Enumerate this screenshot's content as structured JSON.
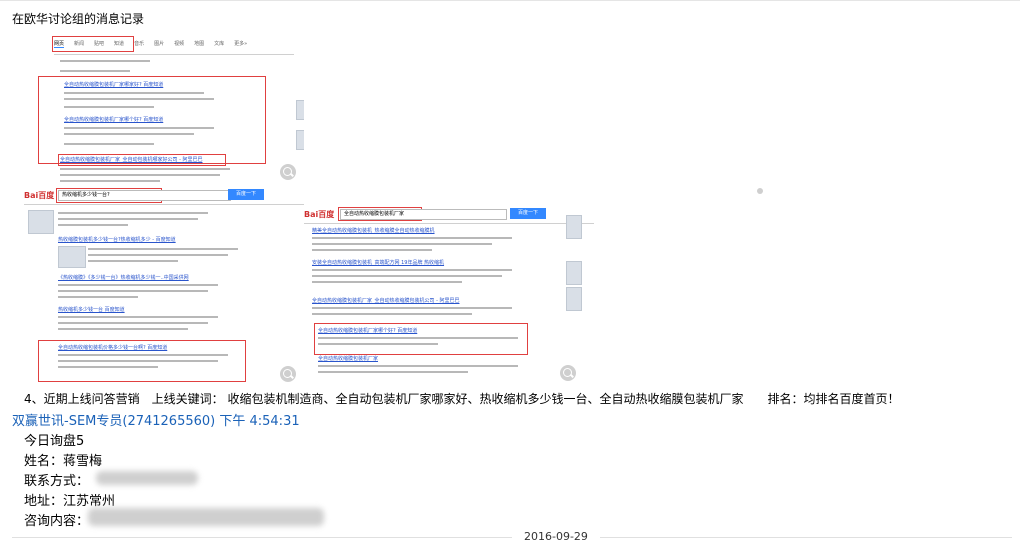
{
  "page": {
    "title": "在欧华讨论组的消息记录"
  },
  "shot_top": {
    "tabs": [
      "网页",
      "新闻",
      "贴吧",
      "知道",
      "音乐",
      "图片",
      "视频",
      "地图",
      "文库",
      "更多»"
    ],
    "results": [
      {
        "link": "全自动热收缩膜包装机厂家哪家好? 百度知道"
      },
      {
        "link": "全自动热收缩膜包装机厂家哪个好? 百度知道"
      },
      {
        "link": "全自动热收缩膜包装机厂家_全自动包装机哪家好公司 - 阿里巴巴"
      }
    ]
  },
  "shot_left": {
    "logo": "Bai百度",
    "query": "热收缩机多少钱一台?",
    "search_button": "百度一下",
    "results": [
      {
        "link": "热收缩膜包装机多少钱一台?热收缩机多少 - 百度知道"
      },
      {
        "link": "《热收缩膜》《多少钱一台》热收缩机多少钱一..中国采供网"
      },
      {
        "link": "热收缩机多少钱一台 百度知道"
      },
      {
        "link": "全自动热收缩包装机价格多少钱一台啊? 百度知道"
      }
    ]
  },
  "shot_right": {
    "logo": "Bai百度",
    "query": "全自动热收缩膜包装机厂家",
    "search_button": "百度一下",
    "results": [
      {
        "link": "精美全自动热收缩膜包装机_热收缩膜全自动热收缩膜机"
      },
      {
        "link": "安装全自动热收缩膜包装机_高端配方网 19年品牌 热收缩机"
      },
      {
        "link": "全自动热收缩膜包装机厂家_全自动热收缩膜包装机公司 - 阿里巴巴"
      },
      {
        "link": "全自动热收缩膜包装机厂家哪个好? 百度知道"
      },
      {
        "link": "全自动热收缩膜包装机厂家"
      }
    ]
  },
  "description": "4、近期上线问答营销　上线关键词：  收缩包装机制造商、全自动包装机厂家哪家好、热收缩机多少钱一台、全自动热收缩膜包装机厂家　　排名：均排名百度首页！",
  "message": {
    "sender": "双赢世讯-SEM专员(2741265560) 下午 4:54:31",
    "lines": {
      "count": "今日询盘5",
      "name": "姓名：蒋雪梅",
      "contact_label": "联系方式：",
      "address": "地址：江苏常州",
      "inquiry_label": "咨询内容："
    }
  },
  "date": "2016-09-29",
  "colors": {
    "sender_blue": "#1b62b8",
    "highlight_red": "#e04040",
    "link_blue": "#2a55cc"
  },
  "icons": [
    "zoom-in-icon",
    "baidu-logo-icon"
  ]
}
